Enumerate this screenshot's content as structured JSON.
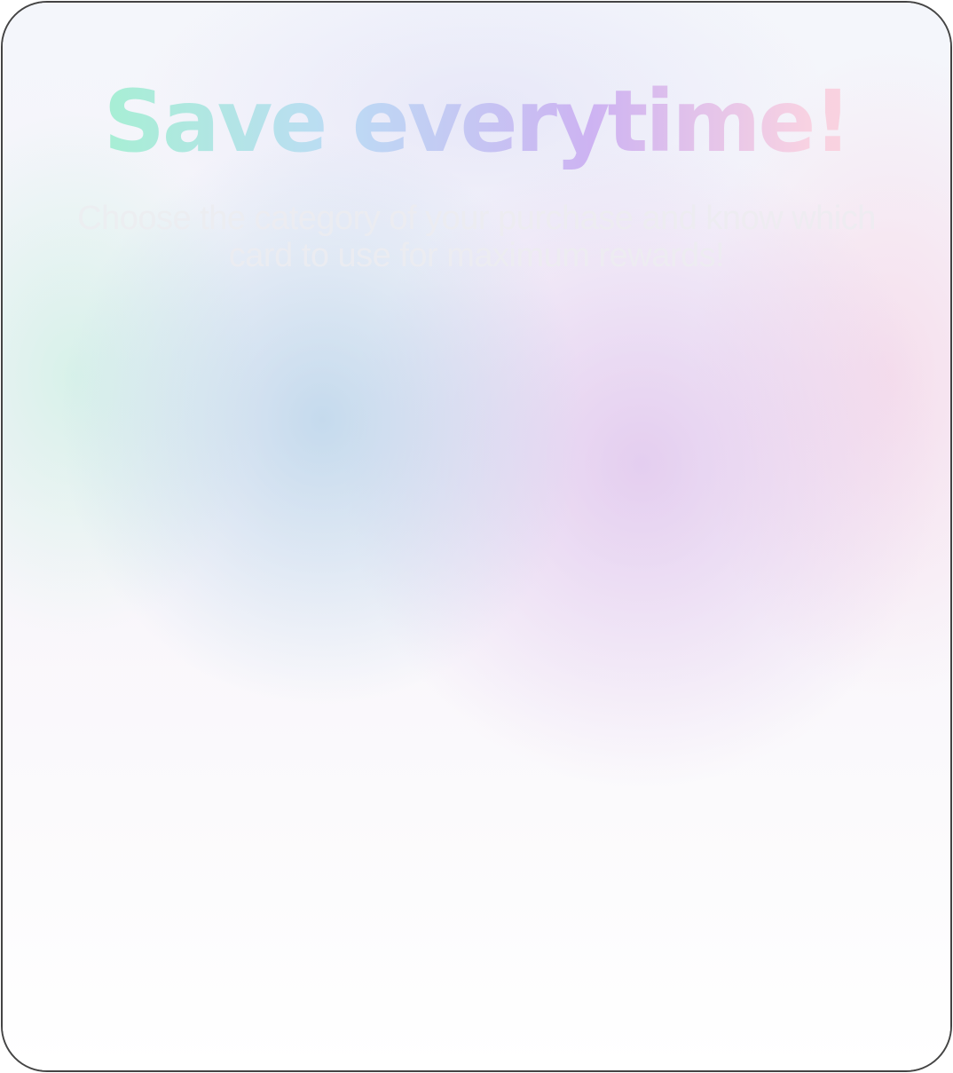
{
  "hero": {
    "title": "Save everytime!",
    "subtitle": "Choose the category of your purchase and know which card to use for maximum rewards!"
  },
  "colors": {
    "title_gradient": [
      "#9ef7c6",
      "#bcdcf4",
      "#cdb3f2",
      "#f8d2e2",
      "#fcd4d8"
    ],
    "subtitle_text": "#ececf0",
    "frame_border": "#444444"
  }
}
